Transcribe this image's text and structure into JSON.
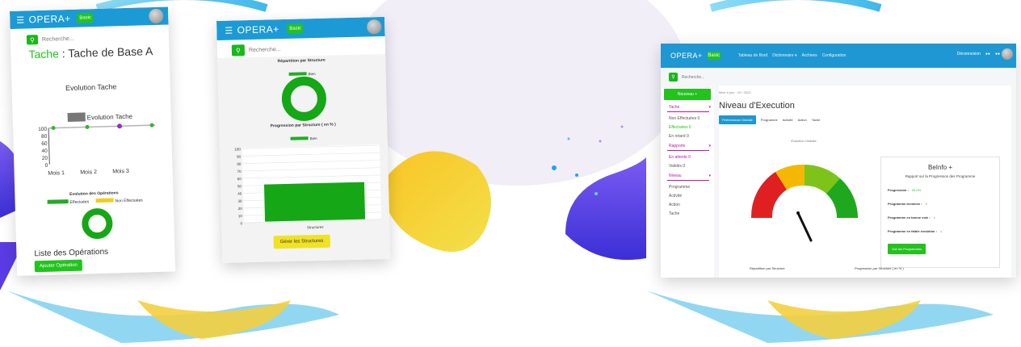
{
  "colors": {
    "topbar": "#1c9ad6",
    "green": "#22c31d",
    "yellow": "#f0e224",
    "pink": "#c0169c",
    "purple": "#5d3ae0"
  },
  "panel1": {
    "brand": "OPERA+",
    "top_button": "Basic",
    "search_placeholder": "Recherche...",
    "tache_label": "Tache",
    "tache_name": ": Tache de Base A",
    "evolution_title": "Evolution Tache",
    "legend_label": "Evolution Tache",
    "y_ticks": [
      "100",
      "80",
      "60",
      "40",
      "20",
      "0"
    ],
    "months": [
      "Mois 1",
      "Mois 2",
      "Mois 3"
    ],
    "operations_title": "Evolution des Opérations",
    "operations_legend": [
      "Effectuées",
      "Non Effectuées"
    ],
    "list_title": "Liste des Opérations",
    "add_button": "Ajouter Opération"
  },
  "panel2": {
    "brand": "OPERA+",
    "top_button": "Basic",
    "search_placeholder": "Recherche...",
    "donut_title": "Répartition par Structure",
    "legend": "Bien",
    "bar_title": "Progression par Structure ( en % )",
    "y_ticks": [
      "100",
      "90",
      "80",
      "70",
      "60",
      "50",
      "40",
      "30",
      "20",
      "10",
      "0"
    ],
    "x_label": "Structures",
    "generate_button": "Gérer les Structures"
  },
  "panel3": {
    "brand": "OPERA+",
    "top_button": "Basic",
    "nav": [
      "Tableau de Bord",
      "Dictionnaire ▾",
      "Archives",
      "Configuration"
    ],
    "nav_right": "Déconnexion",
    "search_placeholder": "Recherche...",
    "sidebar_button": "Nouveau +",
    "sidebar": {
      "tache_head": "Tache",
      "tache_items": [
        "Non Effectuées 0",
        "Effectuées 0",
        "En retard 0"
      ],
      "rapports_head": "Rapports",
      "rapports_items": [
        "En attente 0",
        "Validés 0"
      ],
      "niveau_head": "Niveau",
      "niveau_items": [
        "Programme",
        "Activité",
        "Action",
        "Tache"
      ]
    },
    "breadcrumb": "Mise à jour : 10 / 2022",
    "page_title": "Niveau d'Execution",
    "tabs": [
      "Performance Globale",
      "Programme",
      "Activité",
      "Action",
      "Tache"
    ],
    "gauge_title": "Evolution Globale",
    "info_title": "BeInfo +",
    "info_subtitle": "Rapport sur la Progression des Programme",
    "info_rows": [
      {
        "label": "Progression :",
        "value": "25.0%"
      },
      {
        "label": "Programme terminés :",
        "value": "0"
      },
      {
        "label": "Programme en bonne voie :",
        "value": "1"
      },
      {
        "label": "Programme en faible évolution :",
        "value": "1"
      }
    ],
    "detail_button": "Voir les Programmes",
    "footer_left": "Répartition par Structure",
    "footer_right": "Progression par Structure ( en % )"
  }
}
